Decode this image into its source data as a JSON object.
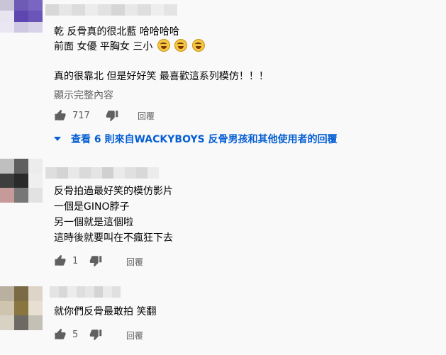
{
  "comments": [
    {
      "avatar_colors": [
        "#c9c4d6",
        "#6e5bb5",
        "#7a66c2",
        "#e8e4f0",
        "#5d46b0",
        "#6b55b8",
        "#eae7f2",
        "#cfc8e3",
        "#d9d3ea"
      ],
      "name_blur": [
        "#d8d8d8",
        "#e6e6e6",
        "#dcdcdc",
        "#ececec",
        "#e2e2e2",
        "#d6d6d6",
        "#e8e8e8",
        "#dedede",
        "#eeeeee",
        "#e4e4e4"
      ],
      "lines": [
        "乾 反骨真的很北藍 哈哈哈哈",
        "前面 女優 平胸女 三小",
        "",
        "真的很靠北 但是好好笑 最喜歡這系列模仿！！！"
      ],
      "show_more": "顯示完整內容",
      "likes": "717",
      "reply_label": "回覆",
      "view_replies": "查看 6 則來自WACKYBOYS 反骨男孩和其他使用者的回覆"
    },
    {
      "avatar_colors": [
        "#bfbfbf",
        "#5f5f5f",
        "#ececec",
        "#3e3e3e",
        "#2a2a2a",
        "#efefef",
        "#c79a9a",
        "#777777",
        "#e2e2e2"
      ],
      "name_blur": [
        "#dedede",
        "#d4d4d4",
        "#e8e8e8",
        "#dadada",
        "#e4e4e4",
        "#d0d0d0",
        "#eaeaea",
        "#e0e0e0",
        "#d8d8d8",
        "#ececec"
      ],
      "lines": [
        "反骨拍過最好笑的模仿影片",
        "一個是GINO脖子",
        "另一個就是這個啦",
        "這時後就要叫在不瘋狂下去"
      ],
      "likes": "1",
      "reply_label": "回覆"
    },
    {
      "avatar_colors": [
        "#b9b0a0",
        "#7a6a45",
        "#ddd6c8",
        "#cfc4ad",
        "#8a7540",
        "#e6dfd2",
        "#d8d2c5",
        "#6c6a62",
        "#c5c0b5"
      ],
      "name_blur": [
        "#e4e4e4",
        "#d8d8d8",
        "#ececec",
        "#dedede",
        "#e6e6e6",
        "#d4d4d4",
        "#eaeaea",
        "#e0e0e0"
      ],
      "lines": [
        "就你們反骨最敢拍 笑翻"
      ],
      "likes": "5",
      "reply_label": "回覆"
    }
  ]
}
